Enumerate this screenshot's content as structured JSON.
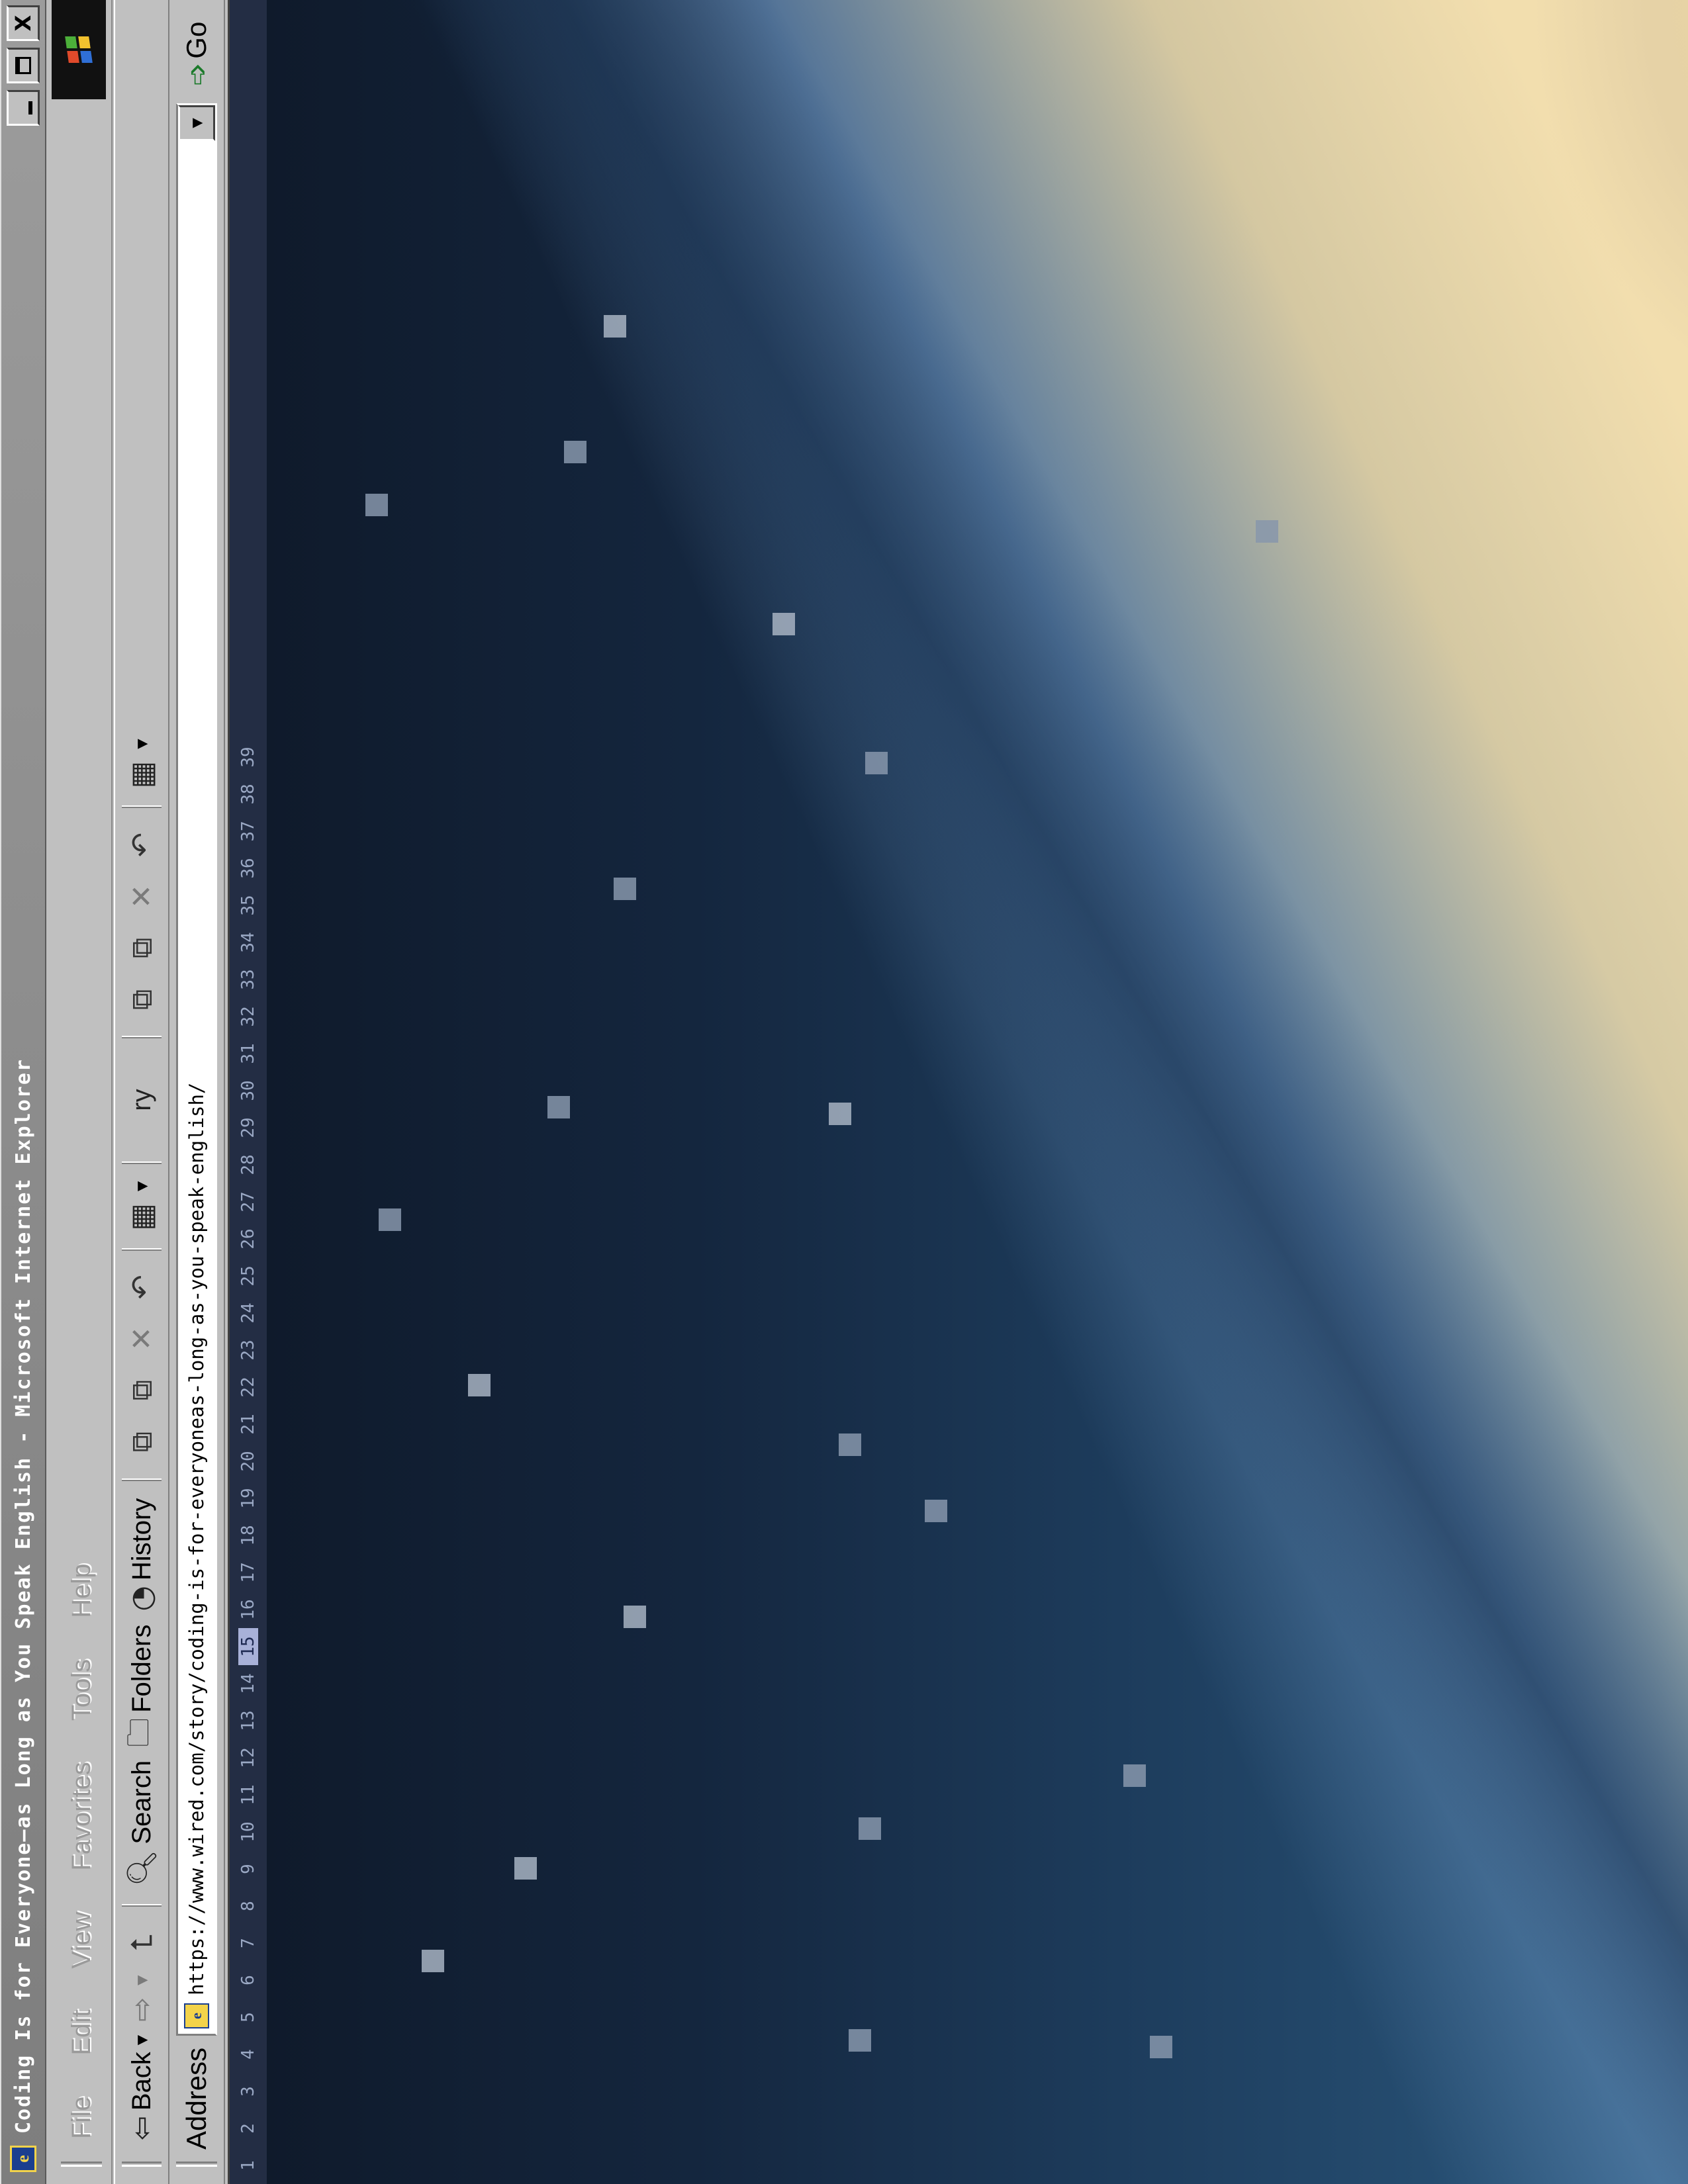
{
  "window": {
    "title": "Coding Is for Everyone—as Long as You Speak English - Microsoft Internet Explorer",
    "controls": {
      "minimize": "-",
      "maximize": "□",
      "close": "X"
    }
  },
  "menubar": {
    "items": [
      "File",
      "Edit",
      "View",
      "Favorites",
      "Tools",
      "Help"
    ]
  },
  "toolbar": {
    "back_label": "Back",
    "search_label": "Search",
    "folders_label": "Folders",
    "history_label": "History",
    "overflow_fragment": "ry"
  },
  "addressbar": {
    "label": "Address",
    "url": "https://www.wired.com/story/coding-is-for-everyoneas-long-as-you-speak-english/",
    "go_label": "Go"
  },
  "content": {
    "line_numbers": [
      "1",
      "2",
      "3",
      "4",
      "5",
      "6",
      "7",
      "8",
      "9",
      "10",
      "11",
      "12",
      "13",
      "14",
      "15",
      "16",
      "17",
      "18",
      "19",
      "20",
      "21",
      "22",
      "23",
      "24",
      "25",
      "26",
      "27",
      "28",
      "29",
      "30",
      "31",
      "32",
      "33",
      "34",
      "35",
      "36",
      "37",
      "38",
      "39"
    ],
    "active_line": "15",
    "background": "pixelated galaxy / night sky image"
  },
  "colors": {
    "sky_dark": "#0f1a2b",
    "sky_mid": "#2c5a80",
    "galaxy_glow": "#f2deae",
    "titlebar": "#8a8a8a",
    "chrome": "#c0c0c0"
  },
  "icons": {
    "title": "ie-page-icon",
    "back": "back-arrow-icon",
    "forward": "forward-arrow-icon",
    "up": "up-folder-icon",
    "search": "search-icon",
    "folders": "folders-icon",
    "history": "history-icon",
    "move_to": "move-to-icon",
    "copy_to": "copy-to-icon",
    "delete": "delete-icon",
    "undo": "undo-icon",
    "views": "views-icon",
    "go": "go-arrow-icon"
  }
}
